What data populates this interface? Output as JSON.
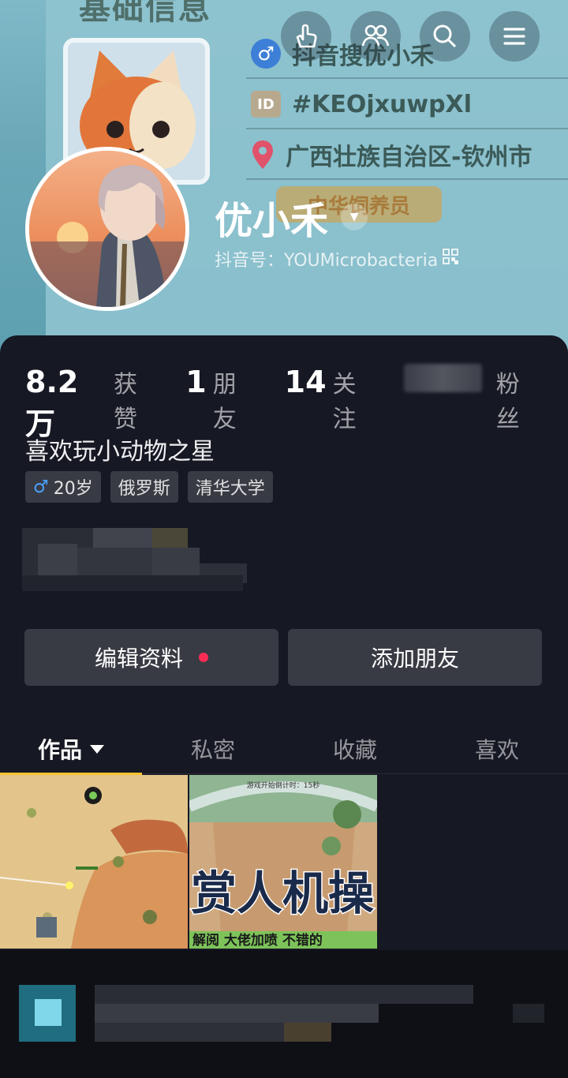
{
  "banner": {
    "title": "基础信息",
    "pet_lines": [
      {
        "icon": "male-icon",
        "text": "抖音搜优小禾"
      },
      {
        "icon": "id-icon",
        "text": "#KEOjxuwpXl"
      },
      {
        "icon": "location-pin-icon",
        "text": "广西壮族自治区-钦州市"
      }
    ],
    "feeder_badge": "中华饲养员"
  },
  "top_buttons": [
    {
      "name": "hand-pointer-icon"
    },
    {
      "name": "friends-icon"
    },
    {
      "name": "search-icon"
    },
    {
      "name": "menu-icon"
    }
  ],
  "profile": {
    "nickname": "优小禾",
    "douyin_id": "抖音号：YOUMicrobacteria"
  },
  "stats": [
    {
      "num": "8.2万",
      "label": "获赞"
    },
    {
      "num": "1",
      "label": "朋友"
    },
    {
      "num": "14",
      "label": "关注"
    },
    {
      "num": "",
      "label": "粉丝"
    }
  ],
  "bio": "喜欢玩小动物之星",
  "tags": {
    "age": "20岁",
    "country": "俄罗斯",
    "school": "清华大学"
  },
  "actions": {
    "edit": "编辑资料",
    "add_friend": "添加朋友"
  },
  "tabs": [
    "作品",
    "私密",
    "收藏",
    "喜欢"
  ],
  "thumbnails": {
    "second_caption_big": "赏人机操",
    "second_caption_small": "解阅 大佬加喷 不错的",
    "second_timer": "游戏开始倒计时：15秒"
  },
  "colors": {
    "background": "#161823",
    "accent_tab": "#fcc32c",
    "notify_dot": "#fe2c55",
    "male_blue": "#4aa2ff"
  }
}
